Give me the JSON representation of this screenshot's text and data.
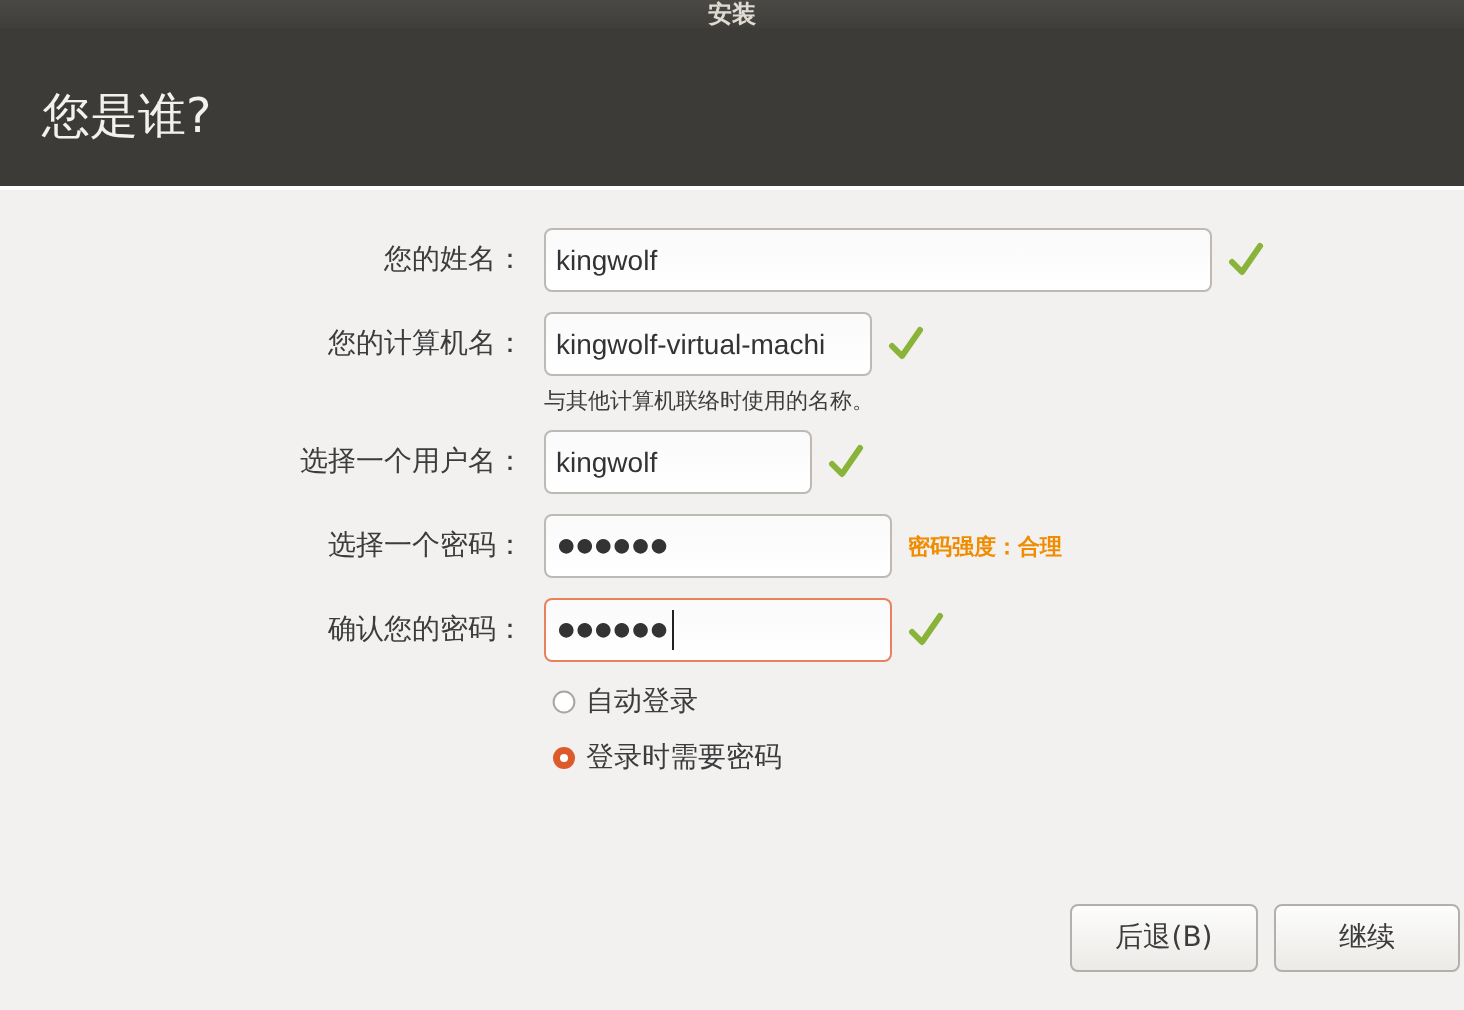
{
  "window": {
    "title": "安装"
  },
  "page_title": "您是谁?",
  "fields": [
    {
      "label": "您的姓名：",
      "kind": "text",
      "value": "kingwolf",
      "valid": true,
      "focused": false
    },
    {
      "label": "您的计算机名：",
      "kind": "text",
      "value": "kingwolf-virtual-machi",
      "valid": true,
      "focused": false,
      "hint": "与其他计算机联络时使用的名称。"
    },
    {
      "label": "选择一个用户名：",
      "kind": "text",
      "value": "kingwolf",
      "valid": true,
      "focused": false
    },
    {
      "label": "选择一个密码：",
      "kind": "password",
      "value": "●●●●●●",
      "valid": false,
      "focused": false,
      "strength": "密码强度：合理"
    },
    {
      "label": "确认您的密码：",
      "kind": "password",
      "value": "●●●●●●",
      "valid": true,
      "focused": true
    }
  ],
  "login_options": [
    {
      "label": "自动登录",
      "selected": false
    },
    {
      "label": "登录时需要密码",
      "selected": true
    }
  ],
  "buttons": [
    {
      "label": "后退(B)"
    },
    {
      "label": "继续"
    }
  ]
}
